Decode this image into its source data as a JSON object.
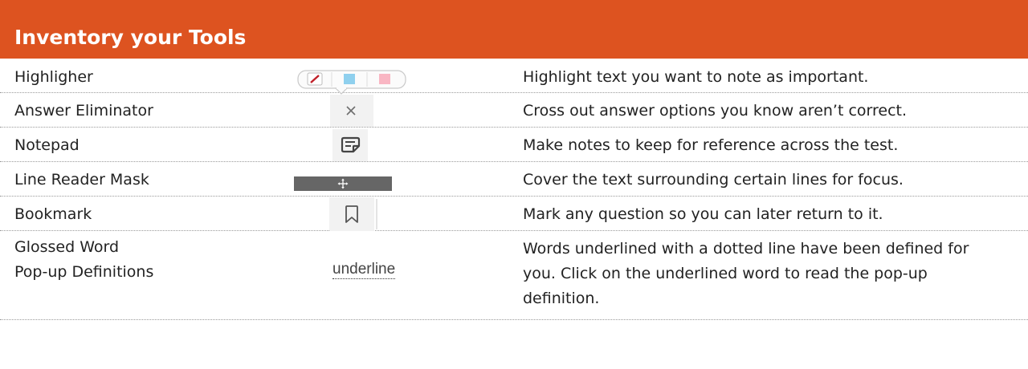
{
  "header": {
    "title": "Inventory your Tools"
  },
  "tools": [
    {
      "name": "Highligher",
      "icon": "highlighter-toolbar-icon",
      "description": "Highlight text you want to note as important."
    },
    {
      "name": "Answer Eliminator",
      "icon": "close-icon",
      "description": "Cross out answer options you know aren’t correct."
    },
    {
      "name": "Notepad",
      "icon": "notepad-icon",
      "description": "Make notes to keep for reference across the test."
    },
    {
      "name": "Line Reader Mask",
      "icon": "move-handle-icon",
      "description": "Cover the text surrounding certain lines for focus."
    },
    {
      "name": "Bookmark",
      "icon": "bookmark-icon",
      "description": "Mark any question so you can later return to it."
    },
    {
      "name_line1": "Glossed Word",
      "name_line2": "Pop-up Definitions",
      "icon_text": "underline",
      "description": "Words underlined with a dotted line have been defined for you. Click on the underlined word to read the pop-up definition."
    }
  ],
  "colors": {
    "header_bg": "#dd5320",
    "highlight_blue": "#8fd0ee",
    "highlight_pink": "#f9b6c3"
  }
}
